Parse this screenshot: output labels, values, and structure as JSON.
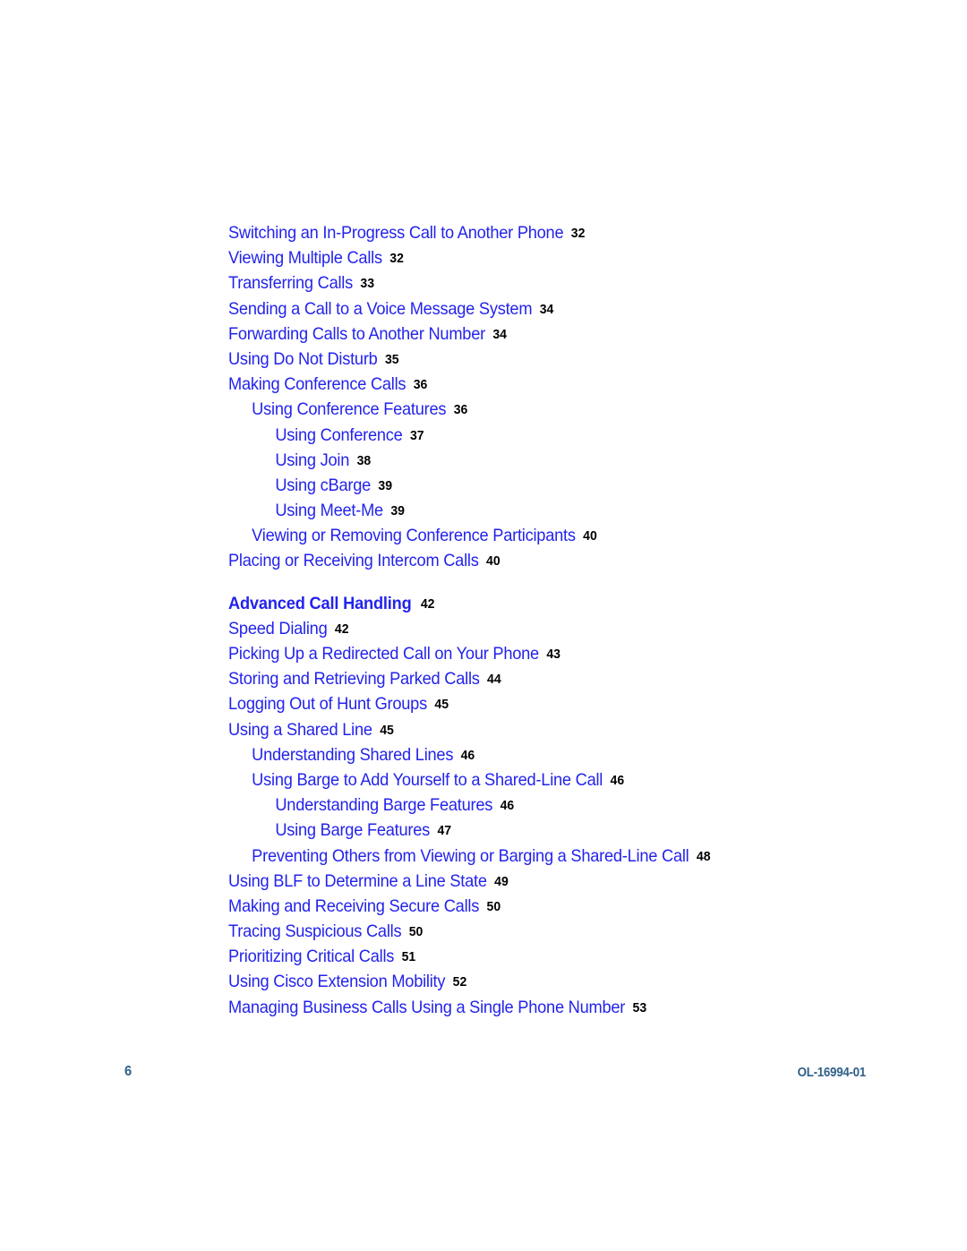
{
  "document": {
    "page_number": "6",
    "doc_id": "OL-16994-01"
  },
  "toc": {
    "entries": [
      {
        "label": "Switching an In-Progress Call to Another Phone",
        "page": "32",
        "level": 1,
        "bold": false
      },
      {
        "label": "Viewing Multiple Calls",
        "page": "32",
        "level": 1,
        "bold": false
      },
      {
        "label": "Transferring Calls",
        "page": "33",
        "level": 1,
        "bold": false
      },
      {
        "label": "Sending a Call to a Voice Message System",
        "page": "34",
        "level": 1,
        "bold": false
      },
      {
        "label": "Forwarding Calls to Another Number",
        "page": "34",
        "level": 1,
        "bold": false
      },
      {
        "label": "Using Do Not Disturb",
        "page": "35",
        "level": 1,
        "bold": false
      },
      {
        "label": "Making Conference Calls",
        "page": "36",
        "level": 1,
        "bold": false
      },
      {
        "label": "Using Conference Features",
        "page": "36",
        "level": 2,
        "bold": false
      },
      {
        "label": "Using Conference",
        "page": "37",
        "level": 3,
        "bold": false
      },
      {
        "label": "Using Join",
        "page": "38",
        "level": 3,
        "bold": false
      },
      {
        "label": "Using cBarge",
        "page": "39",
        "level": 3,
        "bold": false
      },
      {
        "label": "Using Meet-Me",
        "page": "39",
        "level": 3,
        "bold": false
      },
      {
        "label": "Viewing or Removing Conference Participants",
        "page": "40",
        "level": 2,
        "bold": false
      },
      {
        "label": "Placing or Receiving Intercom Calls",
        "page": "40",
        "level": 1,
        "bold": false
      },
      {
        "label": "Advanced Call Handling",
        "page": "42",
        "level": 1,
        "bold": true
      },
      {
        "label": "Speed Dialing",
        "page": "42",
        "level": 1,
        "bold": false
      },
      {
        "label": "Picking Up a Redirected Call on Your Phone",
        "page": "43",
        "level": 1,
        "bold": false
      },
      {
        "label": "Storing and Retrieving Parked Calls",
        "page": "44",
        "level": 1,
        "bold": false
      },
      {
        "label": "Logging Out of Hunt Groups",
        "page": "45",
        "level": 1,
        "bold": false
      },
      {
        "label": "Using a Shared Line",
        "page": "45",
        "level": 1,
        "bold": false
      },
      {
        "label": "Understanding Shared Lines",
        "page": "46",
        "level": 2,
        "bold": false
      },
      {
        "label": "Using Barge to Add Yourself to a Shared-Line Call",
        "page": "46",
        "level": 2,
        "bold": false
      },
      {
        "label": "Understanding Barge Features",
        "page": "46",
        "level": 3,
        "bold": false
      },
      {
        "label": "Using Barge Features",
        "page": "47",
        "level": 3,
        "bold": false
      },
      {
        "label": "Preventing Others from Viewing or Barging a Shared-Line Call",
        "page": "48",
        "level": 2,
        "bold": false
      },
      {
        "label": "Using BLF to Determine a Line State",
        "page": "49",
        "level": 1,
        "bold": false
      },
      {
        "label": "Making and Receiving Secure Calls",
        "page": "50",
        "level": 1,
        "bold": false
      },
      {
        "label": "Tracing Suspicious Calls",
        "page": "50",
        "level": 1,
        "bold": false
      },
      {
        "label": "Prioritizing Critical Calls",
        "page": "51",
        "level": 1,
        "bold": false
      },
      {
        "label": "Using Cisco Extension Mobility",
        "page": "52",
        "level": 1,
        "bold": false
      },
      {
        "label": "Managing Business Calls Using a Single Phone Number",
        "page": "53",
        "level": 1,
        "bold": false
      }
    ]
  },
  "colors": {
    "entry_blue": "#2323ec",
    "page_number_black": "#000000",
    "footer_blue": "#2f6089"
  }
}
